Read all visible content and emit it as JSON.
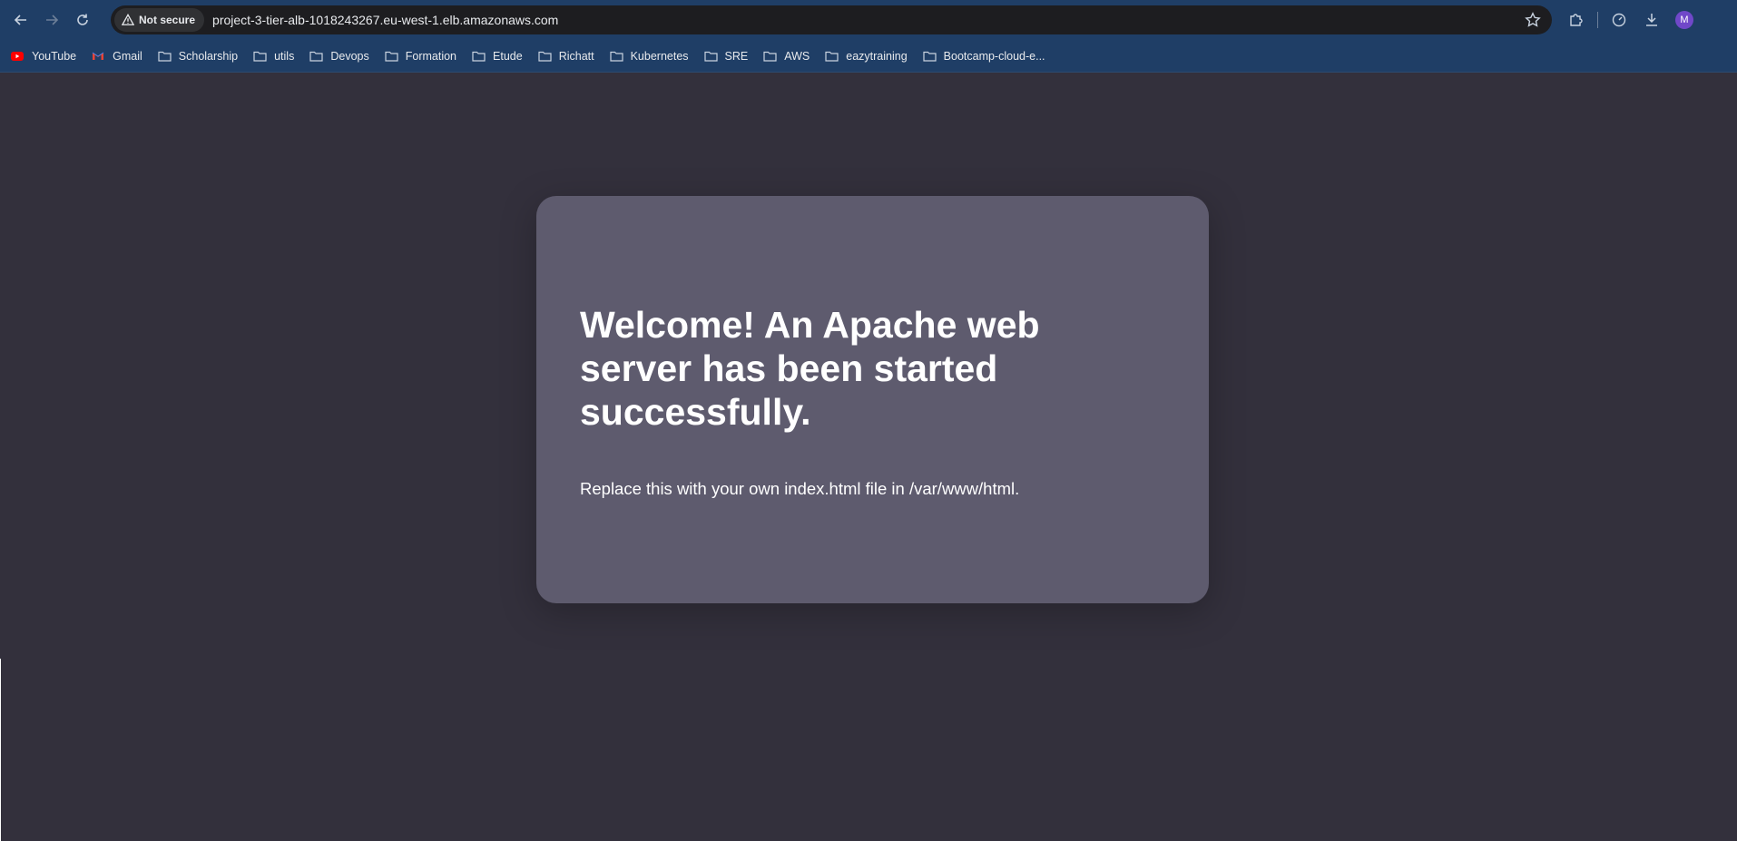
{
  "browser": {
    "security_chip": "Not secure",
    "url": "project-3-tier-alb-1018243267.eu-west-1.elb.amazonaws.com",
    "profile_initial": "M"
  },
  "bookmarks": [
    {
      "label": "YouTube",
      "icon": "youtube-icon"
    },
    {
      "label": "Gmail",
      "icon": "gmail-icon"
    },
    {
      "label": "Scholarship",
      "icon": "folder-icon"
    },
    {
      "label": "utils",
      "icon": "folder-icon"
    },
    {
      "label": "Devops",
      "icon": "folder-icon"
    },
    {
      "label": "Formation",
      "icon": "folder-icon"
    },
    {
      "label": "Etude",
      "icon": "folder-icon"
    },
    {
      "label": "Richatt",
      "icon": "folder-icon"
    },
    {
      "label": "Kubernetes",
      "icon": "folder-icon"
    },
    {
      "label": "SRE",
      "icon": "folder-icon"
    },
    {
      "label": "AWS",
      "icon": "folder-icon"
    },
    {
      "label": "eazytraining",
      "icon": "folder-icon"
    },
    {
      "label": "Bootcamp-cloud-e...",
      "icon": "folder-icon"
    }
  ],
  "page": {
    "heading": "Welcome! An Apache web server has been started successfully.",
    "message": "Replace this with your own index.html file in /var/www/html."
  },
  "colors": {
    "browser_chrome": "#1f3e66",
    "page_background": "#33303c",
    "card_background": "#5e5b6e",
    "text": "#ffffff"
  }
}
